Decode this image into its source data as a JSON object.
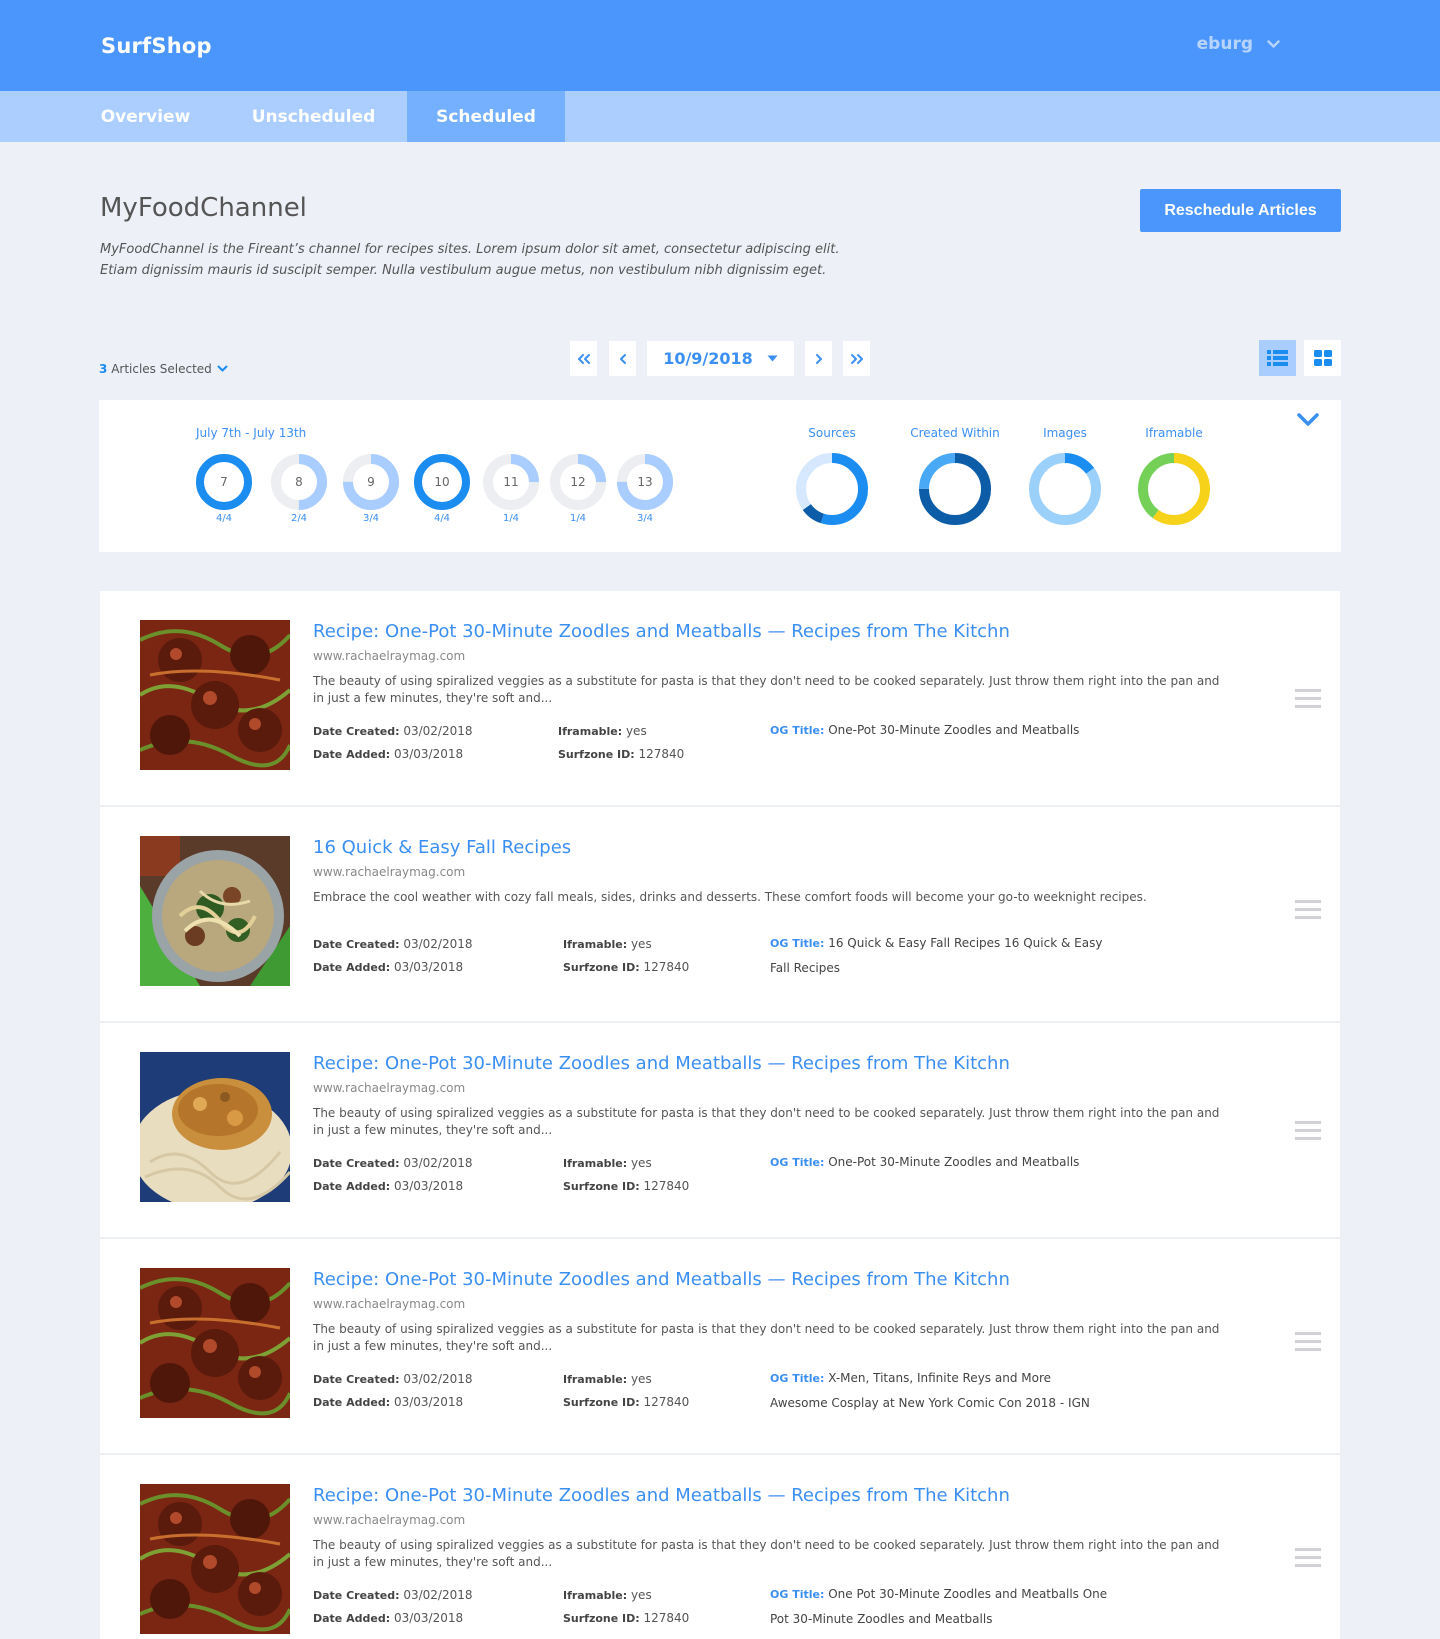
{
  "header": {
    "brand": "SurfShop",
    "user": "eburg"
  },
  "tabs": [
    {
      "label": "Overview"
    },
    {
      "label": "Unscheduled"
    },
    {
      "label": "Scheduled"
    }
  ],
  "channel": {
    "title": "MyFoodChannel",
    "description": "MyFoodChannel is the Fireant’s channel for recipes sites. Lorem ipsum dolor sit amet, consectetur adipiscing elit. Etiam dignissim mauris id suscipit semper. Nulla vestibulum augue metus, non vestibulum nibh dignissim eget.",
    "reschedule_label": "Reschedule Articles"
  },
  "toolbar": {
    "selected_count": "3",
    "selected_label": "Articles Selected",
    "date": "10/9/2018"
  },
  "stats": {
    "range_label": "July 7th - July 13th",
    "days": [
      {
        "day": "7",
        "ratio": "4/4",
        "fraction": 1.0
      },
      {
        "day": "8",
        "ratio": "2/4",
        "fraction": 0.5
      },
      {
        "day": "9",
        "ratio": "3/4",
        "fraction": 0.75
      },
      {
        "day": "10",
        "ratio": "4/4",
        "fraction": 1.0
      },
      {
        "day": "11",
        "ratio": "1/4",
        "fraction": 0.25
      },
      {
        "day": "12",
        "ratio": "1/4",
        "fraction": 0.25
      },
      {
        "day": "13",
        "ratio": "3/4",
        "fraction": 0.75
      }
    ],
    "metrics": [
      {
        "label": "Sources",
        "segments": [
          {
            "fraction": 0.55,
            "color": "#1b8df1"
          },
          {
            "fraction": 0.1,
            "color": "#0c5ca8"
          },
          {
            "fraction": 0.35,
            "color": "#d5e8fd"
          }
        ]
      },
      {
        "label": "Created Within",
        "segments": [
          {
            "fraction": 0.75,
            "color": "#0c5ca8"
          },
          {
            "fraction": 0.25,
            "color": "#4aa9f5"
          }
        ]
      },
      {
        "label": "Images",
        "segments": [
          {
            "fraction": 0.15,
            "color": "#1b8df1"
          },
          {
            "fraction": 0.85,
            "color": "#9bd0fb"
          }
        ]
      },
      {
        "label": "Iframable",
        "segments": [
          {
            "fraction": 0.6,
            "color": "#f7d21a"
          },
          {
            "fraction": 0.4,
            "color": "#74d057"
          }
        ]
      }
    ],
    "colors": {
      "accent": "#1b8df1",
      "light": "#a8cdfe",
      "track": "#eceef1"
    }
  },
  "labels": {
    "date_created": "Date Created:",
    "date_added": "Date Added:",
    "iframable": "Iframable:",
    "surfzone_id": "Surfzone ID:",
    "og_title": "OG Title:"
  },
  "articles": [
    {
      "title": "Recipe: One-Pot 30-Minute Zoodles and Meatballs — Recipes from The Kitchn",
      "url": "www.rachaelraymag.com",
      "description": "The beauty of using spiralized veggies as a substitute for pasta is that they don't need to be cooked separately. Just throw them right into the pan and in just a few minutes, they're soft and...",
      "date_created": "03/02/2018",
      "date_added": "03/03/2018",
      "iframable": "yes",
      "surfzone_id": "127840",
      "og_title": "One-Pot 30-Minute Zoodles and Meatballs",
      "image": "meatballs"
    },
    {
      "title": "16 Quick & Easy Fall Recipes",
      "url": "www.rachaelraymag.com",
      "description": "Embrace the cool weather with cozy fall meals, sides, drinks and desserts. These comfort foods will become your go-to weeknight recipes.",
      "date_created": "03/02/2018",
      "date_added": "03/03/2018",
      "iframable": "yes",
      "surfzone_id": "127840",
      "og_title": "16 Quick & Easy Fall Recipes 16 Quick & Easy Fall Recipes",
      "image": "fall-pasta"
    },
    {
      "title": "Recipe: One-Pot 30-Minute Zoodles and Meatballs — Recipes from The Kitchn",
      "url": "www.rachaelraymag.com",
      "description": "The beauty of using spiralized veggies as a substitute for pasta is that they don't need to be cooked separately. Just throw them right into the pan and in just a few minutes, they're soft and...",
      "date_created": "03/02/2018",
      "date_added": "03/03/2018",
      "iframable": "yes",
      "surfzone_id": "127840",
      "og_title": "One-Pot 30-Minute Zoodles and Meatballs",
      "image": "spaghetti"
    },
    {
      "title": "Recipe: One-Pot 30-Minute Zoodles and Meatballs — Recipes from The Kitchn",
      "url": "www.rachaelraymag.com",
      "description": "The beauty of using spiralized veggies as a substitute for pasta is that they don't need to be cooked separately. Just throw them right into the pan and in just a few minutes, they're soft and...",
      "date_created": "03/02/2018",
      "date_added": "03/03/2018",
      "iframable": "yes",
      "surfzone_id": "127840",
      "og_title": "X-Men, Titans, Infinite Reys and More Awesome Cosplay at New York Comic Con 2018 - IGN",
      "image": "meatballs"
    },
    {
      "title": "Recipe: One-Pot 30-Minute Zoodles and Meatballs — Recipes from The Kitchn",
      "url": "www.rachaelraymag.com",
      "description": "The beauty of using spiralized veggies as a substitute for pasta is that they don't need to be cooked separately. Just throw them right into the pan and in just a few minutes, they're soft and...",
      "date_created": "03/02/2018",
      "date_added": "03/03/2018",
      "iframable": "yes",
      "surfzone_id": "127840",
      "og_title": "One Pot 30-Minute Zoodles and Meatballs One Pot 30-Minute Zoodles and Meatballs",
      "image": "meatballs"
    }
  ]
}
